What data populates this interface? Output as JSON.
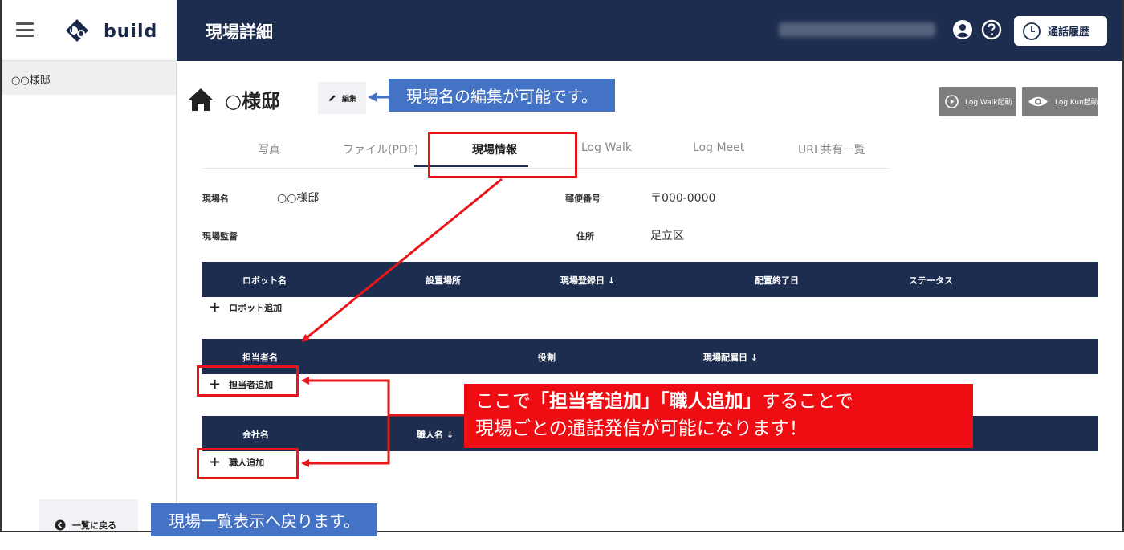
{
  "header": {
    "logo_text": "build",
    "page_title": "現場詳細",
    "history_label": "通話履歴"
  },
  "sidebar": {
    "items": [
      {
        "label": "○○様邸"
      }
    ],
    "back_label": "一覧に戻る"
  },
  "site": {
    "name": "○様邸",
    "edit_label": "編集",
    "log_walk_label": "Log Walk起動",
    "log_kun_label": "Log Kun起動"
  },
  "tabs": [
    {
      "label": "写真"
    },
    {
      "label": "ファイル(PDF)"
    },
    {
      "label": "現場情報",
      "active": true
    },
    {
      "label": "Log Walk"
    },
    {
      "label": "Log Meet"
    },
    {
      "label": "URL共有一覧"
    }
  ],
  "info": {
    "site_name_label": "現場名",
    "site_name_value": "○○様邸",
    "postal_label": "郵便番号",
    "postal_value": "〒000-0000",
    "supervisor_label": "現場監督",
    "address_label": "住所",
    "address_value": "足立区"
  },
  "robot_table": {
    "headers": [
      "ロボット名",
      "設置場所",
      "現場登録日",
      "配置終了日",
      "ステータス"
    ],
    "add_label": "ロボット追加"
  },
  "staff_table": {
    "headers": [
      "担当者名",
      "役割",
      "現場配属日"
    ],
    "add_label": "担当者追加"
  },
  "worker_table": {
    "headers": [
      "会社名",
      "職人名"
    ],
    "add_label": "職人追加"
  },
  "annotations": {
    "edit_note": "現場名の編集が可能です。",
    "back_note": "現場一覧表示へ戻ります。",
    "main_note_line1_a": "ここで",
    "main_note_line1_b": "「担当者追加」「職人追加」",
    "main_note_line1_c": "することで",
    "main_note_line2": "現場ごとの通話発信が可能になります！"
  },
  "colors": {
    "navy": "#1d2d4f",
    "annotation_red": "#e8161b",
    "annotation_blue": "#4472c4"
  }
}
